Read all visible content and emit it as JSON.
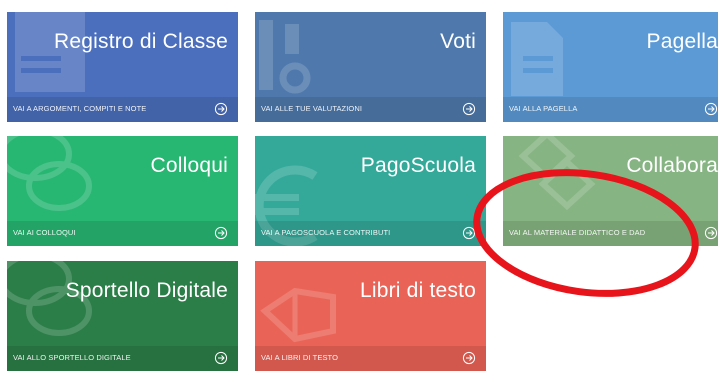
{
  "tiles": [
    {
      "title": "Registro di Classe",
      "footer": "VAI A ARGOMENTI, COMPITI E NOTE",
      "icon": "document-icon",
      "color": "#4b6fbd"
    },
    {
      "title": "Voti",
      "footer": "VAI ALLE TUE VALUTAZIONI",
      "icon": "grades-icon",
      "color": "#4f79ac"
    },
    {
      "title": "Pagella",
      "footer": "VAI ALLA PAGELLA",
      "icon": "report-card-icon",
      "color": "#5c9ad6"
    },
    {
      "title": "Colloqui",
      "footer": "VAI AI COLLOQUI",
      "icon": "chat-bubbles-icon",
      "color": "#27b772"
    },
    {
      "title": "PagoScuola",
      "footer": "VAI A PAGOSCUOLA E CONTRIBUTI",
      "icon": "euro-icon",
      "color": "#34a99a"
    },
    {
      "title": "Collabora",
      "footer": "VAI AL MATERIALE DIDATTICO E DAD",
      "icon": "collaborate-icon",
      "color": "#86b482"
    },
    {
      "title": "Sportello Digitale",
      "footer": "VAI ALLO SPORTELLO DIGITALE",
      "icon": "chat-bubbles-icon",
      "color": "#2c7e48"
    },
    {
      "title": "Libri di testo",
      "footer": "VAI A LIBRI DI TESTO",
      "icon": "books-icon",
      "color": "#ea6357"
    }
  ],
  "annotation": {
    "shape": "ellipse",
    "color": "#e8141b"
  }
}
